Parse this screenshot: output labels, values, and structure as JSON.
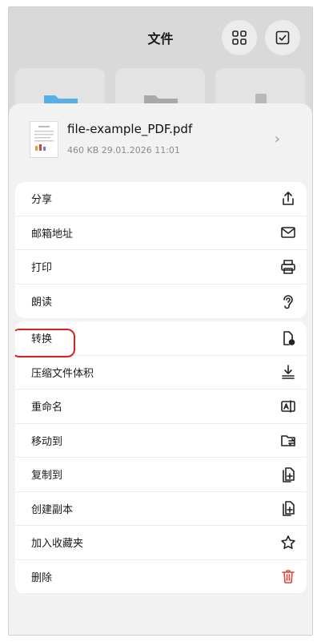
{
  "header": {
    "title": "文件"
  },
  "file": {
    "name": "file-example_PDF.pdf",
    "meta": "460 KB 29.01.2026 11:01"
  },
  "actions_group1": [
    {
      "label": "分享",
      "icon": "share-icon"
    },
    {
      "label": "邮箱地址",
      "icon": "mail-icon"
    },
    {
      "label": "打印",
      "icon": "printer-icon"
    },
    {
      "label": "朗读",
      "icon": "ear-icon"
    }
  ],
  "actions_group2": [
    {
      "label": "转换",
      "icon": "convert-file-icon"
    },
    {
      "label": "压缩文件体积",
      "icon": "compress-icon"
    },
    {
      "label": "重命名",
      "icon": "rename-icon"
    },
    {
      "label": "移动到",
      "icon": "move-folder-icon"
    },
    {
      "label": "复制到",
      "icon": "copy-icon"
    },
    {
      "label": "创建副本",
      "icon": "duplicate-icon"
    },
    {
      "label": "加入收藏夹",
      "icon": "star-icon"
    },
    {
      "label": "删除",
      "icon": "trash-icon"
    }
  ],
  "colors": {
    "danger": "#e0453a",
    "highlight": "#e0201c"
  }
}
